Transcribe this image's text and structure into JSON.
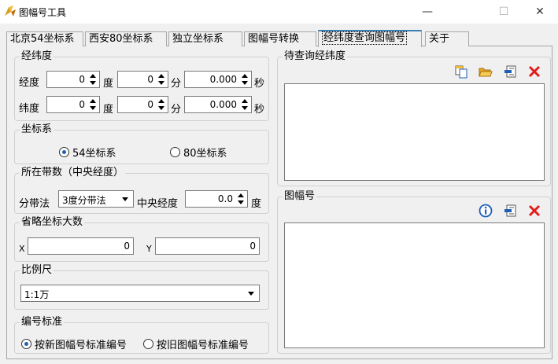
{
  "window": {
    "title": "图幅号工具",
    "minimize_glyph": "—",
    "maximize_glyph": "☐",
    "close_glyph": "✕"
  },
  "tabs": [
    {
      "label": "北京54坐标系"
    },
    {
      "label": "西安80坐标系"
    },
    {
      "label": "独立坐标系"
    },
    {
      "label": "图幅号转换"
    },
    {
      "label": "经纬度查询图幅号",
      "active": true
    },
    {
      "label": "关于"
    }
  ],
  "latlon_group": {
    "title": "经纬度",
    "lon_label": "经度",
    "lat_label": "纬度",
    "deg_unit": "度",
    "min_unit": "分",
    "sec_unit": "秒",
    "lon": {
      "deg": "0",
      "min": "0",
      "sec": "0.000"
    },
    "lat": {
      "deg": "0",
      "min": "0",
      "sec": "0.000"
    }
  },
  "coord_group": {
    "title": "坐标系",
    "option_54": "54坐标系",
    "option_80": "80坐标系",
    "selected": "54"
  },
  "zone_group": {
    "title": "所在带数（中央经度）",
    "method_label": "分带法",
    "method_value": "3度分带法",
    "central_label": "中央经度",
    "central_value": "0.0",
    "deg_unit": "度"
  },
  "omit_group": {
    "title": "省略坐标大数",
    "x_label": "X",
    "x_value": "0",
    "y_label": "Y",
    "y_value": "0"
  },
  "scale_group": {
    "title": "比例尺",
    "value": "1:1万"
  },
  "standard_group": {
    "title": "编号标准",
    "option_new": "按新图幅号标准编号",
    "option_old": "按旧图幅号标准编号",
    "selected": "new"
  },
  "query_group": {
    "title": "待查询经纬度"
  },
  "result_group": {
    "title": "图幅号"
  },
  "colors": {
    "accent": "#3c7fb1",
    "delete_red": "#e0201b",
    "info_blue": "#1e5fb5",
    "folder_yellow": "#f0b83a"
  }
}
